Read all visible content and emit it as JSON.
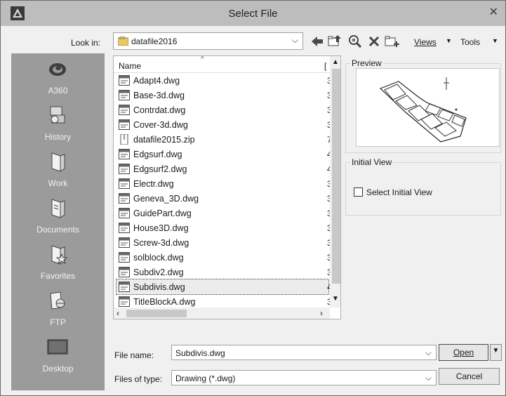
{
  "window": {
    "title": "Select File",
    "close_glyph": "✕"
  },
  "toolbar": {
    "lookin_label": "Look in:",
    "lookin_value": "datafile2016",
    "views_label": "Views",
    "tools_label": "Tools",
    "icons": [
      "back-arrow-icon",
      "up-folder-icon",
      "search-web-icon",
      "delete-icon",
      "new-folder-icon"
    ]
  },
  "places": [
    {
      "label": "A360",
      "icon": "a360-icon"
    },
    {
      "label": "History",
      "icon": "history-icon"
    },
    {
      "label": "Work",
      "icon": "work-folder-icon"
    },
    {
      "label": "Documents",
      "icon": "documents-icon"
    },
    {
      "label": "Favorites",
      "icon": "favorites-icon"
    },
    {
      "label": "FTP",
      "icon": "ftp-icon"
    },
    {
      "label": "Desktop",
      "icon": "desktop-icon"
    }
  ],
  "filelist": {
    "header_name": "Name",
    "header_col2": "[",
    "files": [
      {
        "name": "Adapt4.dwg",
        "col2": "3",
        "type": "dwg"
      },
      {
        "name": "Base-3d.dwg",
        "col2": "3",
        "type": "dwg"
      },
      {
        "name": "Contrdat.dwg",
        "col2": "3",
        "type": "dwg"
      },
      {
        "name": "Cover-3d.dwg",
        "col2": "3",
        "type": "dwg"
      },
      {
        "name": "datafile2015.zip",
        "col2": "7",
        "type": "zip"
      },
      {
        "name": "Edgsurf.dwg",
        "col2": "4",
        "type": "dwg"
      },
      {
        "name": "Edgsurf2.dwg",
        "col2": "4",
        "type": "dwg"
      },
      {
        "name": "Electr.dwg",
        "col2": "3",
        "type": "dwg"
      },
      {
        "name": "Geneva_3D.dwg",
        "col2": "3",
        "type": "dwg"
      },
      {
        "name": "GuidePart.dwg",
        "col2": "3",
        "type": "dwg"
      },
      {
        "name": "House3D.dwg",
        "col2": "3",
        "type": "dwg"
      },
      {
        "name": "Screw-3d.dwg",
        "col2": "3",
        "type": "dwg"
      },
      {
        "name": "solblock.dwg",
        "col2": "3",
        "type": "dwg"
      },
      {
        "name": "Subdiv2.dwg",
        "col2": "3",
        "type": "dwg"
      },
      {
        "name": "Subdivis.dwg",
        "col2": "4",
        "type": "dwg",
        "selected": true
      },
      {
        "name": "TitleBlockA.dwg",
        "col2": "3",
        "type": "dwg"
      }
    ]
  },
  "preview": {
    "title": "Preview"
  },
  "initial_view": {
    "title": "Initial View",
    "checkbox_label": "Select Initial View",
    "checked": false
  },
  "footer": {
    "filename_label": "File name:",
    "filename_value": "Subdivis.dwg",
    "filetype_label": "Files of type:",
    "filetype_value": "Drawing (*.dwg)",
    "open_label": "Open",
    "cancel_label": "Cancel"
  }
}
